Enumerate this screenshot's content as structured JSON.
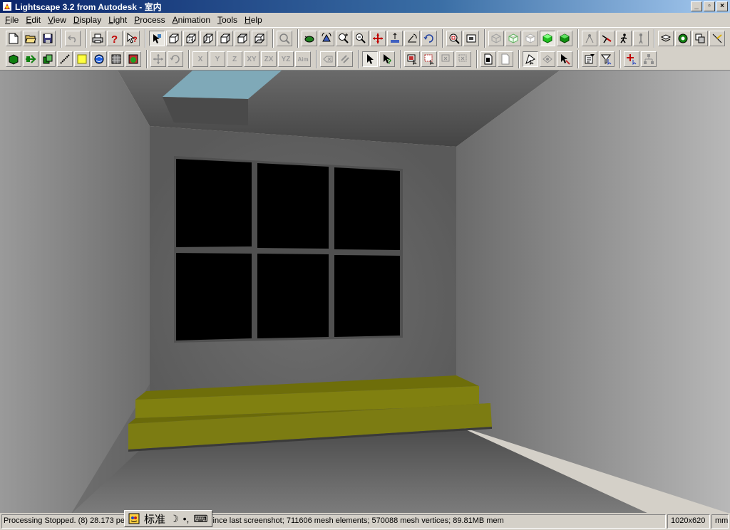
{
  "window": {
    "title": "Lightscape 3.2 from Autodesk - 室内",
    "buttons": [
      "_",
      "▫",
      "×"
    ]
  },
  "menubar": [
    {
      "label": "File",
      "mnemonic": "F"
    },
    {
      "label": "Edit",
      "mnemonic": "E"
    },
    {
      "label": "View",
      "mnemonic": "V"
    },
    {
      "label": "Display",
      "mnemonic": "D"
    },
    {
      "label": "Light",
      "mnemonic": "L"
    },
    {
      "label": "Process",
      "mnemonic": "P"
    },
    {
      "label": "Animation",
      "mnemonic": "A"
    },
    {
      "label": "Tools",
      "mnemonic": "T"
    },
    {
      "label": "Help",
      "mnemonic": "H"
    }
  ],
  "toolbar2_text": {
    "x": "X",
    "y": "Y",
    "z": "Z",
    "xy": "XY",
    "zx": "ZX",
    "yz": "YZ",
    "aim": "Aim"
  },
  "status": {
    "message": "Processing Stopped.  (8) 28.173 percent converged; 1 shot since last screenshot; 711606 mesh elements; 570088 mesh vertices; 89.81MB mem",
    "resolution": "1020x620",
    "unit": "mm"
  },
  "ime": {
    "mode": "标准",
    "moon": "☽",
    "punct": "•,",
    "keyboard": "⌨"
  },
  "colors": {
    "title_active": "#0a246a",
    "wall_left": "#8a8a8a",
    "wall_right": "#a8a8a8",
    "steps": "#808010",
    "window_glass": "#000000",
    "skylight": "#7fa9b8"
  },
  "icons": {
    "toolbar1": [
      "new-file-icon",
      "open-folder-icon",
      "save-disk-icon",
      "undo-icon",
      "print-icon",
      "help-question-icon",
      "context-help-icon",
      "select-material-icon",
      "view-front-icon",
      "view-back-icon",
      "view-left-icon",
      "view-right-icon",
      "view-top-icon",
      "view-bottom-icon",
      "zoom-object-icon",
      "orbit-icon",
      "walk-icon",
      "zoom-in-icon",
      "zoom-out-icon",
      "pan-icon",
      "dolly-icon",
      "tilt-icon",
      "rotate-icon",
      "zoom-window-icon",
      "frame-all-icon",
      "wireframe-icon",
      "hidden-line-icon",
      "outline-icon",
      "solid-icon",
      "textured-icon",
      "light-source-icon",
      "spotlight-icon",
      "walker-icon",
      "figure-icon",
      "layers-icon",
      "radiosity-icon",
      "render-icon",
      "ray-trace-icon"
    ]
  }
}
